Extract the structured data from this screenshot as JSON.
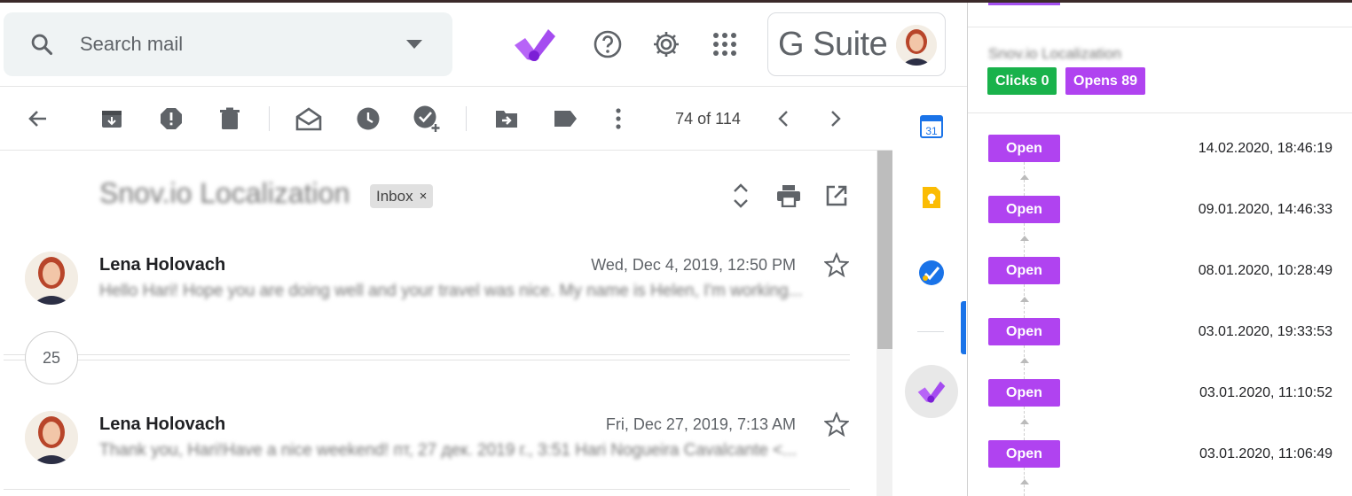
{
  "search": {
    "placeholder": "Search mail"
  },
  "header": {
    "icons": [
      "snov-logo-icon",
      "help-icon",
      "settings-icon",
      "apps-grid-icon"
    ],
    "gsuite_label": "G Suite"
  },
  "toolbar": {
    "pager_text": "74 of 114",
    "icons": [
      "back-arrow-icon",
      "archive-icon",
      "report-spam-icon",
      "delete-icon",
      "mark-unread-icon",
      "snooze-icon",
      "add-to-tasks-icon",
      "move-to-icon",
      "label-icon",
      "more-vert-icon",
      "prev-icon",
      "next-icon"
    ]
  },
  "thread": {
    "subject": "Snov.io Localization",
    "label_chip": "Inbox",
    "chip_close": "×",
    "collapsed_count": "25",
    "messages": [
      {
        "sender": "Lena Holovach",
        "date": "Wed, Dec 4, 2019, 12:50 PM",
        "snippet": "Hello Hari! Hope you are doing well and your travel was nice. My name is Helen, I'm working..."
      },
      {
        "sender": "Lena Holovach",
        "date": "Fri, Dec 27, 2019, 7:13 AM",
        "snippet": "Thank you, Hari!Have a nice weekend! пт, 27 дек. 2019 г., 3:51 Hari Nogueira Cavalcante <..."
      }
    ]
  },
  "side_rail": {
    "icons": [
      "calendar-icon",
      "keep-icon",
      "tasks-icon",
      "snov-addon-icon"
    ],
    "calendar_day": "31"
  },
  "tracking_panel": {
    "title": "Snov.io Localization",
    "clicks_label": "Clicks 0",
    "opens_label": "Opens 89",
    "events": [
      {
        "label": "Open",
        "timestamp": "14.02.2020, 18:46:19"
      },
      {
        "label": "Open",
        "timestamp": "09.01.2020, 14:46:33"
      },
      {
        "label": "Open",
        "timestamp": "08.01.2020, 10:28:49"
      },
      {
        "label": "Open",
        "timestamp": "03.01.2020, 19:33:53"
      },
      {
        "label": "Open",
        "timestamp": "03.01.2020, 11:10:52"
      },
      {
        "label": "Open",
        "timestamp": "03.01.2020, 11:06:49"
      }
    ]
  },
  "colors": {
    "accent_purple": "#b043f0",
    "clicks_green": "#19b24b",
    "gmail_blue": "#1a73e8"
  }
}
